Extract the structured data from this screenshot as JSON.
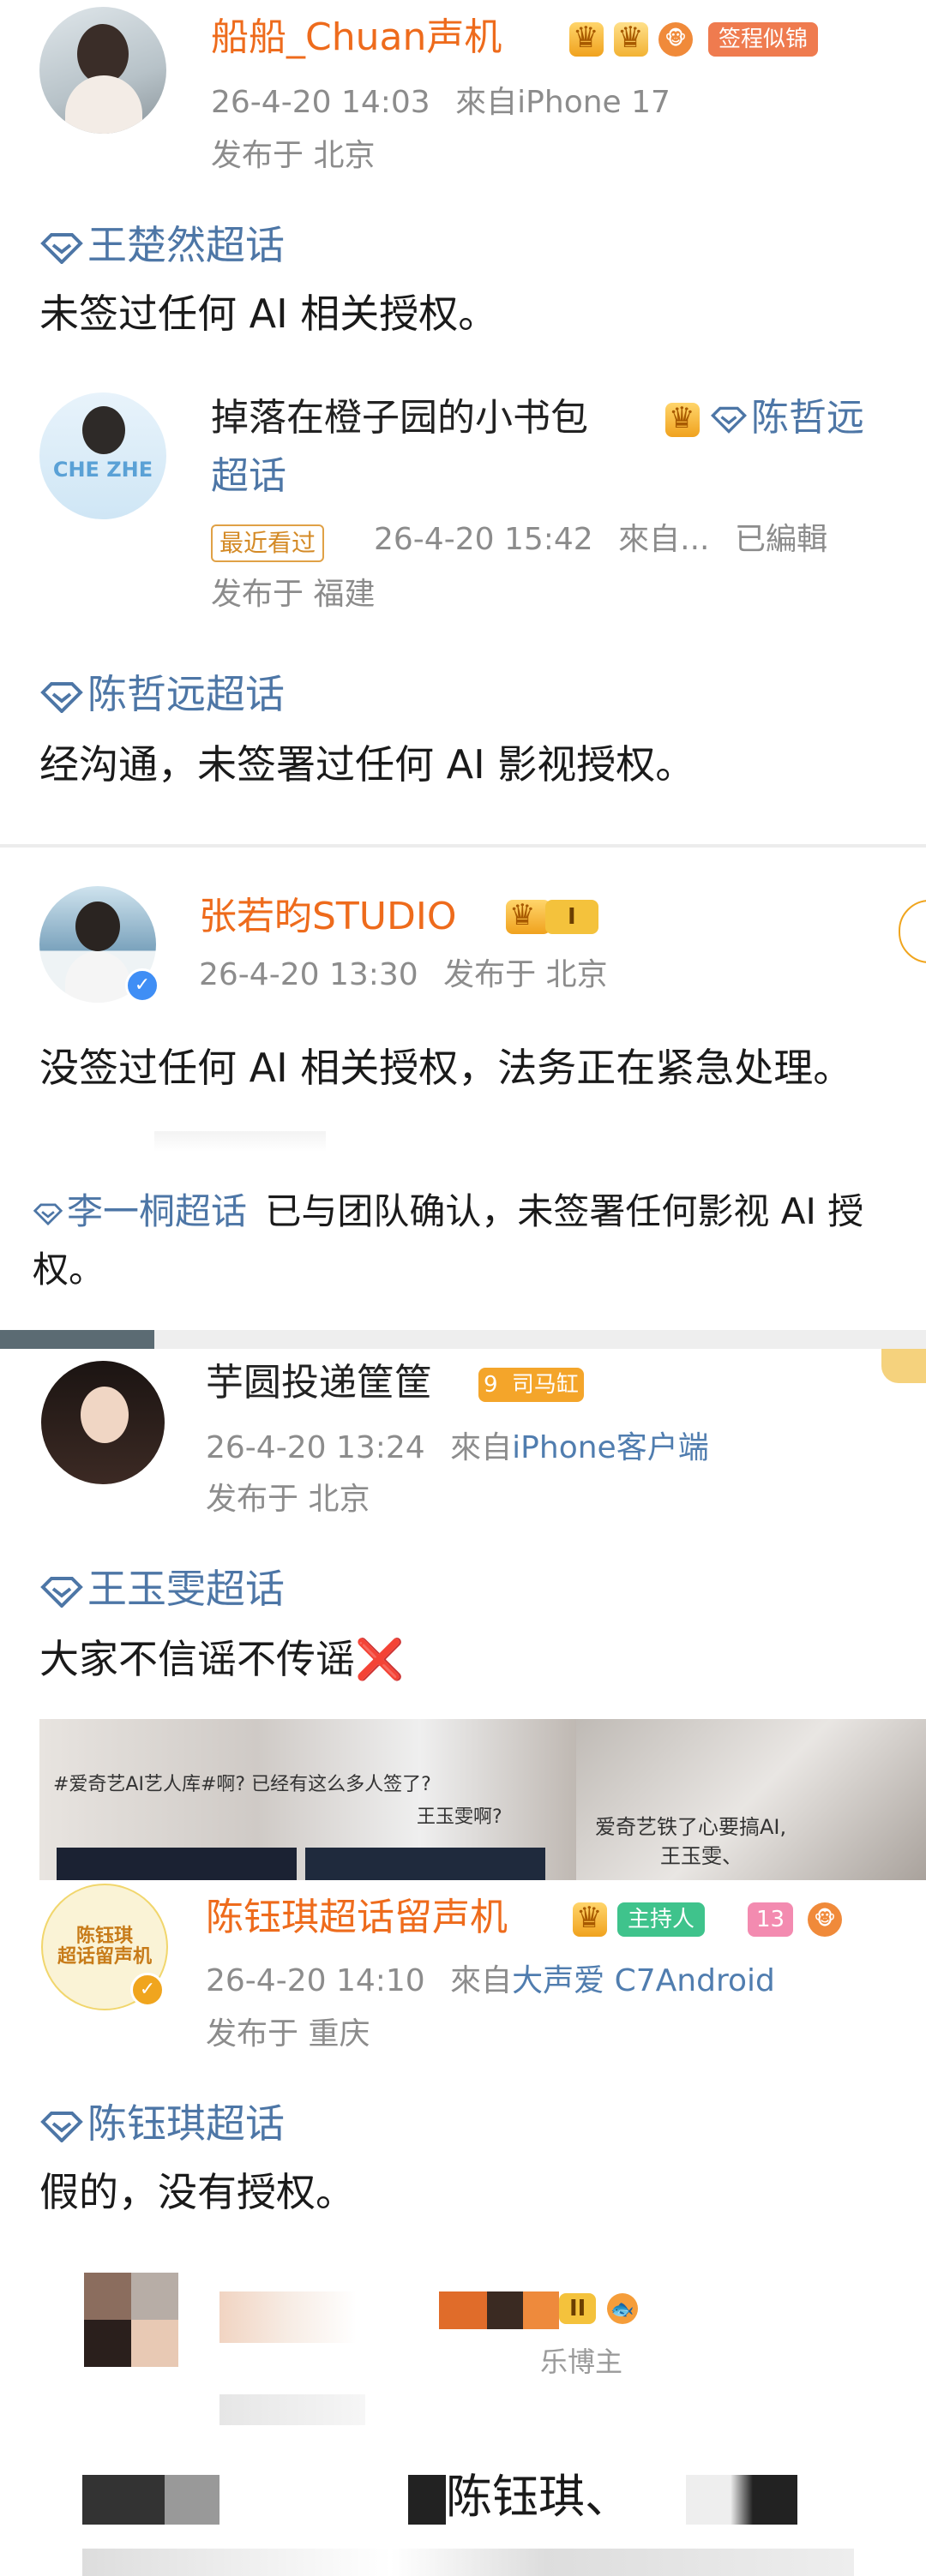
{
  "colors": {
    "name_orange": "#ee6b1c",
    "topic_blue": "#4d76a6",
    "meta_gray": "#8c8c8c",
    "link_blue": "#507daf"
  },
  "posts": [
    {
      "avatar_icon": "avatar-woman-photo",
      "name": "船船_Chuan声机",
      "signin_badge": "签程似锦",
      "time": "26-4-20 14:03",
      "source_prefix": "來自",
      "source": "iPhone 17",
      "location": "发布于 北京",
      "topic": "王楚然超话",
      "text": "未签过任何 AI 相关授权。"
    },
    {
      "avatar_text": "CHE ZHE",
      "name": "掉落在橙子园的小书包",
      "name_topic": "陈哲远",
      "name_topic_suffix": "超话",
      "recent_tag": "最近看过",
      "time": "26-4-20 15:42",
      "source_prefix": "來自...",
      "edited": "已編輯",
      "location": "发布于 福建",
      "topic": "陈哲远超话",
      "text": "经沟通，未签署过任何 AI 影视授权。"
    },
    {
      "name": "张若昀STUDIO",
      "level": "I",
      "time": "26-4-20 13:30",
      "location": "发布于 北京",
      "text": "没签过任何 AI 相关授权，法务正在紧急处理。"
    },
    {
      "topic": "李一桐超话",
      "text_line1": "已与团队确认，未签署任何影视 AI 授",
      "text_line2": "权。"
    },
    {
      "name": "芋圆投递筐筐",
      "level_badge": "9",
      "badge_label": "司马缸",
      "time": "26-4-20 13:24",
      "source_prefix": "來自",
      "source": "iPhone客户端",
      "location": "发布于 北京",
      "topic": "王玉雯超话",
      "text": "大家不信谣不传谣",
      "cross": "❌",
      "image_caption_1": "#爱奇艺AI艺人库#啊? 已经有这么多人签了?",
      "image_caption_2": "王玉雯啊?",
      "image_caption_3": "爱奇艺铁了心要搞AI,",
      "image_caption_4": "王玉雯、"
    },
    {
      "avatar_line1": "陈钰琪",
      "avatar_line2": "超话留声机",
      "name": "陈钰琪超话留声机",
      "host_badge": "主持人",
      "level_num": "13",
      "time": "26-4-20 14:10",
      "source_prefix": "來自",
      "source": "大声爱 C7Android",
      "location": "发布于 重庆",
      "topic": "陈钰琪超话",
      "text": "假的，没有授权。"
    }
  ],
  "bottom": {
    "label_partial": "乐博主",
    "level": "II",
    "names_partial": "陈钰琪、"
  }
}
